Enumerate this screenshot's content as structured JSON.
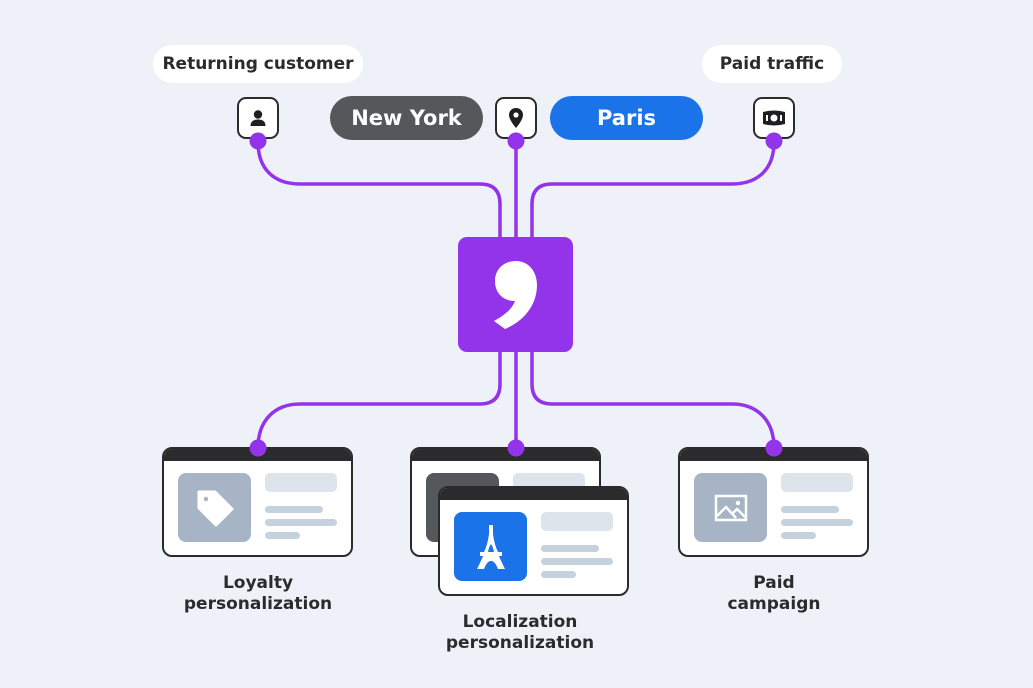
{
  "inputs": {
    "returning_customer": {
      "label": "Returning customer",
      "icon": "user-icon"
    },
    "location": {
      "icon": "map-pin-icon",
      "from_city": "New York",
      "to_city": "Paris"
    },
    "paid_traffic": {
      "label": "Paid traffic",
      "icon": "banknote-icon"
    }
  },
  "hub": {
    "icon": "comma-logo-icon"
  },
  "outputs": [
    {
      "label_line1": "Loyalty",
      "label_line2": "personalization",
      "icon": "price-tag-icon"
    },
    {
      "label_line1": "Localization",
      "label_line2": "personalization",
      "icon": "eiffel-tower-icon"
    },
    {
      "label_line1": "Paid",
      "label_line2": "campaign",
      "icon": "image-icon"
    }
  ],
  "colors": {
    "background": "#eef2f8",
    "accent_purple": "#9333ea",
    "paris_blue": "#1a73e8",
    "new_york_gray": "#56575b",
    "dark": "#2b2b2e",
    "thumb_gray": "#a6b4c6"
  }
}
